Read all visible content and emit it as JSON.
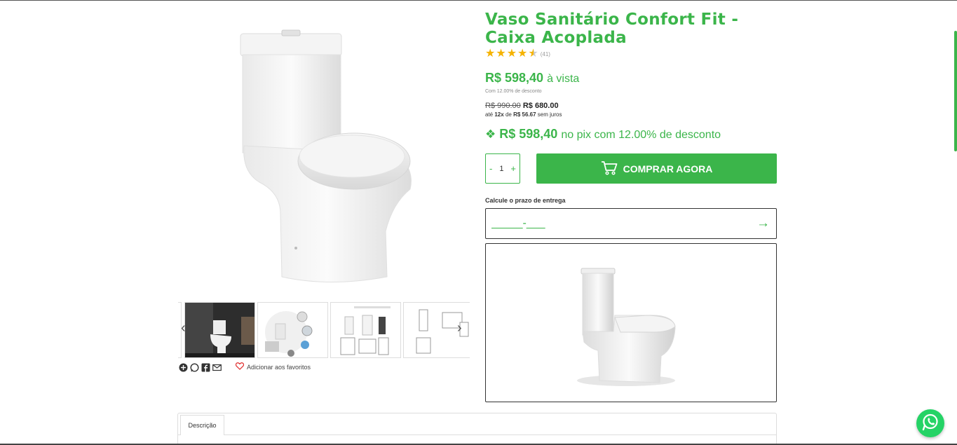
{
  "product": {
    "title": "Vaso Sanitário Confort Fit - Caixa Acoplada",
    "rating": {
      "stars": 4.5,
      "count_label": "(41)"
    },
    "price": {
      "main": "R$ 598,40",
      "main_suffix": "à vista",
      "discount_note": "Com 12.00% de desconto",
      "old": "R$ 990.00",
      "new": "R$ 680.00",
      "installments_prefix": "até",
      "installments_count": "12x",
      "installments_de": "de",
      "installments_value": "R$ 56.67",
      "installments_suffix": "sem juros",
      "pix_value": "R$ 598,40",
      "pix_suffix": "no pix com 12.00% de desconto"
    }
  },
  "quantity": {
    "minus": "-",
    "value": "1",
    "plus": "+"
  },
  "buy_button": {
    "label": "COMPRAR AGORA"
  },
  "shipping": {
    "label": "Calcule o prazo de entrega",
    "cep_value": "_____-___"
  },
  "favorites": {
    "label": "Adicionar aos favoritos"
  },
  "tabs": [
    {
      "label": "Descrição"
    }
  ],
  "colors": {
    "brand": "#3bb54a",
    "star": "#f5b301",
    "whatsapp": "#25d366"
  },
  "icons": {
    "share": [
      "plus-circle-icon",
      "whatsapp-icon",
      "facebook-icon",
      "email-icon"
    ],
    "favorite": "heart-icon",
    "cart": "cart-icon",
    "arrow": "arrow-right-icon"
  }
}
